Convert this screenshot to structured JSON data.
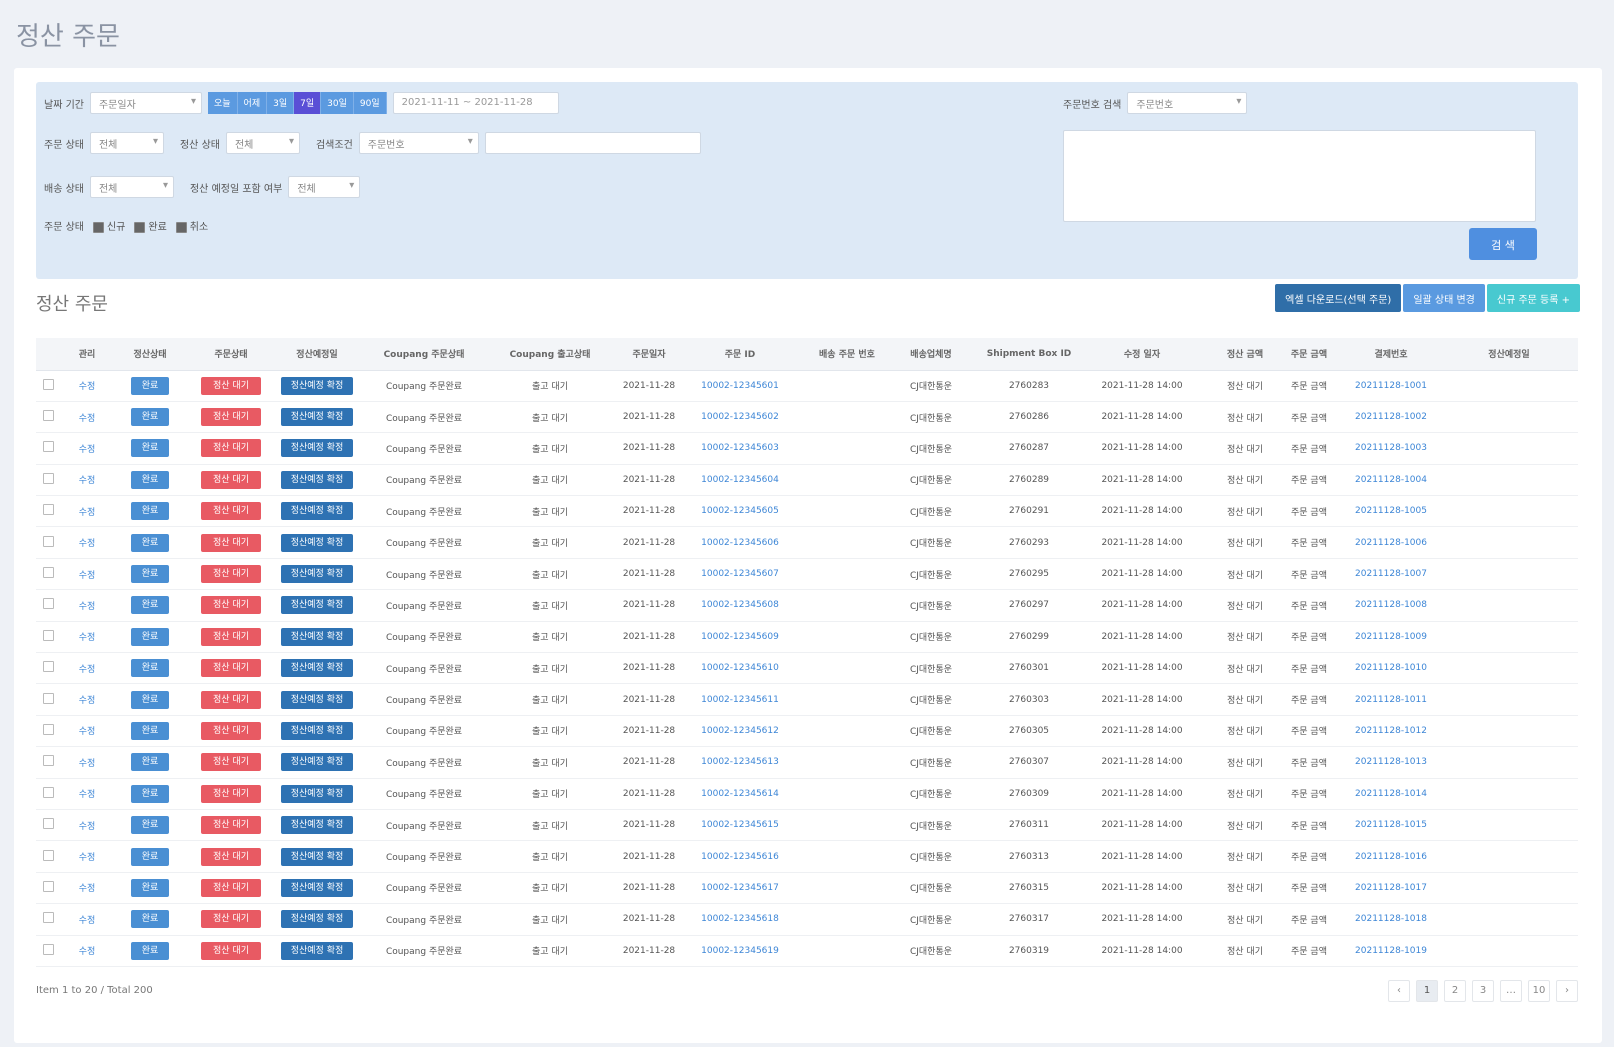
{
  "page_title": "정산 주문",
  "filter": {
    "period_label": "날짜 기간",
    "period_select": "주문일자",
    "date_pills": [
      "오늘",
      "어제",
      "3일",
      "7일",
      "30일",
      "90일"
    ],
    "date_pill_active_index": 3,
    "date_range": "2021-11-11 ~ 2021-11-28",
    "row2": [
      {
        "label": "주문 상태",
        "value": "전체"
      },
      {
        "label": "정산 상태",
        "value": "전체"
      }
    ],
    "search_field_label": "검색조건",
    "search_field_value": "주문번호",
    "search_field_input": "",
    "row3": [
      {
        "label": "배송 상태",
        "value": "전체"
      },
      {
        "label": "정산 예정일 포함 여부",
        "value": "전체"
      }
    ],
    "checkbox_group_label": "주문 상태",
    "checkboxes": [
      "신규",
      "완료",
      "취소"
    ],
    "right_label": "주문번호 검색",
    "right_select": "주문번호",
    "search_button": "검 색"
  },
  "list_title": "정산 주문",
  "actions": {
    "excel_download": "엑셀 다운로드(선택 주문)",
    "bulk_edit": "일괄 상태 변경",
    "register": "신규 주문 등록 +"
  },
  "table": {
    "columns": [
      "",
      "관리",
      "정산상태",
      "주문상태",
      "정산예정일",
      "Coupang 주문상태",
      "Coupang 출고상태",
      "주문일자",
      "주문 ID",
      "",
      "배송 주문 번호",
      "배송업체명",
      "Shipment Box ID",
      "수정 일자",
      "",
      "정산 금액",
      "주문 금액",
      "결제번호",
      "정산예정일"
    ],
    "rows": [
      {
        "edit": "수정",
        "s1": "완료",
        "s2": "정산 대기",
        "s3": "정산예정 확정",
        "c1": "Coupang 주문완료",
        "c2": "출고 대기",
        "date": "2021-11-28",
        "order_id": "10002-12345601",
        "ship": "",
        "carrier": "CJ대한통운",
        "box": "2760283",
        "mod": "2021-11-28 14:00",
        "amt1": "정산 대기",
        "amt2": "주문 금액",
        "pay": "20211128-1001"
      },
      {
        "edit": "수정",
        "s1": "완료",
        "s2": "정산 대기",
        "s3": "정산예정 확정",
        "c1": "Coupang 주문완료",
        "c2": "출고 대기",
        "date": "2021-11-28",
        "order_id": "10002-12345602",
        "ship": "",
        "carrier": "CJ대한통운",
        "box": "2760286",
        "mod": "2021-11-28 14:00",
        "amt1": "정산 대기",
        "amt2": "주문 금액",
        "pay": "20211128-1002"
      },
      {
        "edit": "수정",
        "s1": "완료",
        "s2": "정산 대기",
        "s3": "정산예정 확정",
        "c1": "Coupang 주문완료",
        "c2": "출고 대기",
        "date": "2021-11-28",
        "order_id": "10002-12345603",
        "ship": "",
        "carrier": "CJ대한통운",
        "box": "2760287",
        "mod": "2021-11-28 14:00",
        "amt1": "정산 대기",
        "amt2": "주문 금액",
        "pay": "20211128-1003"
      },
      {
        "edit": "수정",
        "s1": "완료",
        "s2": "정산 대기",
        "s3": "정산예정 확정",
        "c1": "Coupang 주문완료",
        "c2": "출고 대기",
        "date": "2021-11-28",
        "order_id": "10002-12345604",
        "ship": "",
        "carrier": "CJ대한통운",
        "box": "2760289",
        "mod": "2021-11-28 14:00",
        "amt1": "정산 대기",
        "amt2": "주문 금액",
        "pay": "20211128-1004"
      },
      {
        "edit": "수정",
        "s1": "완료",
        "s2": "정산 대기",
        "s3": "정산예정 확정",
        "c1": "Coupang 주문완료",
        "c2": "출고 대기",
        "date": "2021-11-28",
        "order_id": "10002-12345605",
        "ship": "",
        "carrier": "CJ대한통운",
        "box": "2760291",
        "mod": "2021-11-28 14:00",
        "amt1": "정산 대기",
        "amt2": "주문 금액",
        "pay": "20211128-1005"
      },
      {
        "edit": "수정",
        "s1": "완료",
        "s2": "정산 대기",
        "s3": "정산예정 확정",
        "c1": "Coupang 주문완료",
        "c2": "출고 대기",
        "date": "2021-11-28",
        "order_id": "10002-12345606",
        "ship": "",
        "carrier": "CJ대한통운",
        "box": "2760293",
        "mod": "2021-11-28 14:00",
        "amt1": "정산 대기",
        "amt2": "주문 금액",
        "pay": "20211128-1006"
      },
      {
        "edit": "수정",
        "s1": "완료",
        "s2": "정산 대기",
        "s3": "정산예정 확정",
        "c1": "Coupang 주문완료",
        "c2": "출고 대기",
        "date": "2021-11-28",
        "order_id": "10002-12345607",
        "ship": "",
        "carrier": "CJ대한통운",
        "box": "2760295",
        "mod": "2021-11-28 14:00",
        "amt1": "정산 대기",
        "amt2": "주문 금액",
        "pay": "20211128-1007"
      },
      {
        "edit": "수정",
        "s1": "완료",
        "s2": "정산 대기",
        "s3": "정산예정 확정",
        "c1": "Coupang 주문완료",
        "c2": "출고 대기",
        "date": "2021-11-28",
        "order_id": "10002-12345608",
        "ship": "",
        "carrier": "CJ대한통운",
        "box": "2760297",
        "mod": "2021-11-28 14:00",
        "amt1": "정산 대기",
        "amt2": "주문 금액",
        "pay": "20211128-1008"
      },
      {
        "edit": "수정",
        "s1": "완료",
        "s2": "정산 대기",
        "s3": "정산예정 확정",
        "c1": "Coupang 주문완료",
        "c2": "출고 대기",
        "date": "2021-11-28",
        "order_id": "10002-12345609",
        "ship": "",
        "carrier": "CJ대한통운",
        "box": "2760299",
        "mod": "2021-11-28 14:00",
        "amt1": "정산 대기",
        "amt2": "주문 금액",
        "pay": "20211128-1009"
      },
      {
        "edit": "수정",
        "s1": "완료",
        "s2": "정산 대기",
        "s3": "정산예정 확정",
        "c1": "Coupang 주문완료",
        "c2": "출고 대기",
        "date": "2021-11-28",
        "order_id": "10002-12345610",
        "ship": "",
        "carrier": "CJ대한통운",
        "box": "2760301",
        "mod": "2021-11-28 14:00",
        "amt1": "정산 대기",
        "amt2": "주문 금액",
        "pay": "20211128-1010"
      },
      {
        "edit": "수정",
        "s1": "완료",
        "s2": "정산 대기",
        "s3": "정산예정 확정",
        "c1": "Coupang 주문완료",
        "c2": "출고 대기",
        "date": "2021-11-28",
        "order_id": "10002-12345611",
        "ship": "",
        "carrier": "CJ대한통운",
        "box": "2760303",
        "mod": "2021-11-28 14:00",
        "amt1": "정산 대기",
        "amt2": "주문 금액",
        "pay": "20211128-1011"
      },
      {
        "edit": "수정",
        "s1": "완료",
        "s2": "정산 대기",
        "s3": "정산예정 확정",
        "c1": "Coupang 주문완료",
        "c2": "출고 대기",
        "date": "2021-11-28",
        "order_id": "10002-12345612",
        "ship": "",
        "carrier": "CJ대한통운",
        "box": "2760305",
        "mod": "2021-11-28 14:00",
        "amt1": "정산 대기",
        "amt2": "주문 금액",
        "pay": "20211128-1012"
      },
      {
        "edit": "수정",
        "s1": "완료",
        "s2": "정산 대기",
        "s3": "정산예정 확정",
        "c1": "Coupang 주문완료",
        "c2": "출고 대기",
        "date": "2021-11-28",
        "order_id": "10002-12345613",
        "ship": "",
        "carrier": "CJ대한통운",
        "box": "2760307",
        "mod": "2021-11-28 14:00",
        "amt1": "정산 대기",
        "amt2": "주문 금액",
        "pay": "20211128-1013"
      },
      {
        "edit": "수정",
        "s1": "완료",
        "s2": "정산 대기",
        "s3": "정산예정 확정",
        "c1": "Coupang 주문완료",
        "c2": "출고 대기",
        "date": "2021-11-28",
        "order_id": "10002-12345614",
        "ship": "",
        "carrier": "CJ대한통운",
        "box": "2760309",
        "mod": "2021-11-28 14:00",
        "amt1": "정산 대기",
        "amt2": "주문 금액",
        "pay": "20211128-1014"
      },
      {
        "edit": "수정",
        "s1": "완료",
        "s2": "정산 대기",
        "s3": "정산예정 확정",
        "c1": "Coupang 주문완료",
        "c2": "출고 대기",
        "date": "2021-11-28",
        "order_id": "10002-12345615",
        "ship": "",
        "carrier": "CJ대한통운",
        "box": "2760311",
        "mod": "2021-11-28 14:00",
        "amt1": "정산 대기",
        "amt2": "주문 금액",
        "pay": "20211128-1015"
      },
      {
        "edit": "수정",
        "s1": "완료",
        "s2": "정산 대기",
        "s3": "정산예정 확정",
        "c1": "Coupang 주문완료",
        "c2": "출고 대기",
        "date": "2021-11-28",
        "order_id": "10002-12345616",
        "ship": "",
        "carrier": "CJ대한통운",
        "box": "2760313",
        "mod": "2021-11-28 14:00",
        "amt1": "정산 대기",
        "amt2": "주문 금액",
        "pay": "20211128-1016"
      },
      {
        "edit": "수정",
        "s1": "완료",
        "s2": "정산 대기",
        "s3": "정산예정 확정",
        "c1": "Coupang 주문완료",
        "c2": "출고 대기",
        "date": "2021-11-28",
        "order_id": "10002-12345617",
        "ship": "",
        "carrier": "CJ대한통운",
        "box": "2760315",
        "mod": "2021-11-28 14:00",
        "amt1": "정산 대기",
        "amt2": "주문 금액",
        "pay": "20211128-1017"
      },
      {
        "edit": "수정",
        "s1": "완료",
        "s2": "정산 대기",
        "s3": "정산예정 확정",
        "c1": "Coupang 주문완료",
        "c2": "출고 대기",
        "date": "2021-11-28",
        "order_id": "10002-12345618",
        "ship": "",
        "carrier": "CJ대한통운",
        "box": "2760317",
        "mod": "2021-11-28 14:00",
        "amt1": "정산 대기",
        "amt2": "주문 금액",
        "pay": "20211128-1018"
      },
      {
        "edit": "수정",
        "s1": "완료",
        "s2": "정산 대기",
        "s3": "정산예정 확정",
        "c1": "Coupang 주문완료",
        "c2": "출고 대기",
        "date": "2021-11-28",
        "order_id": "10002-12345619",
        "ship": "",
        "carrier": "CJ대한통운",
        "box": "2760319",
        "mod": "2021-11-28 14:00",
        "amt1": "정산 대기",
        "amt2": "주문 금액",
        "pay": "20211128-1019"
      }
    ]
  },
  "footer": {
    "info": "Item 1 to 20 / Total 200"
  },
  "pager": [
    "‹",
    "1",
    "2",
    "3",
    "…",
    "10",
    "›"
  ],
  "pager_active_index": 1
}
